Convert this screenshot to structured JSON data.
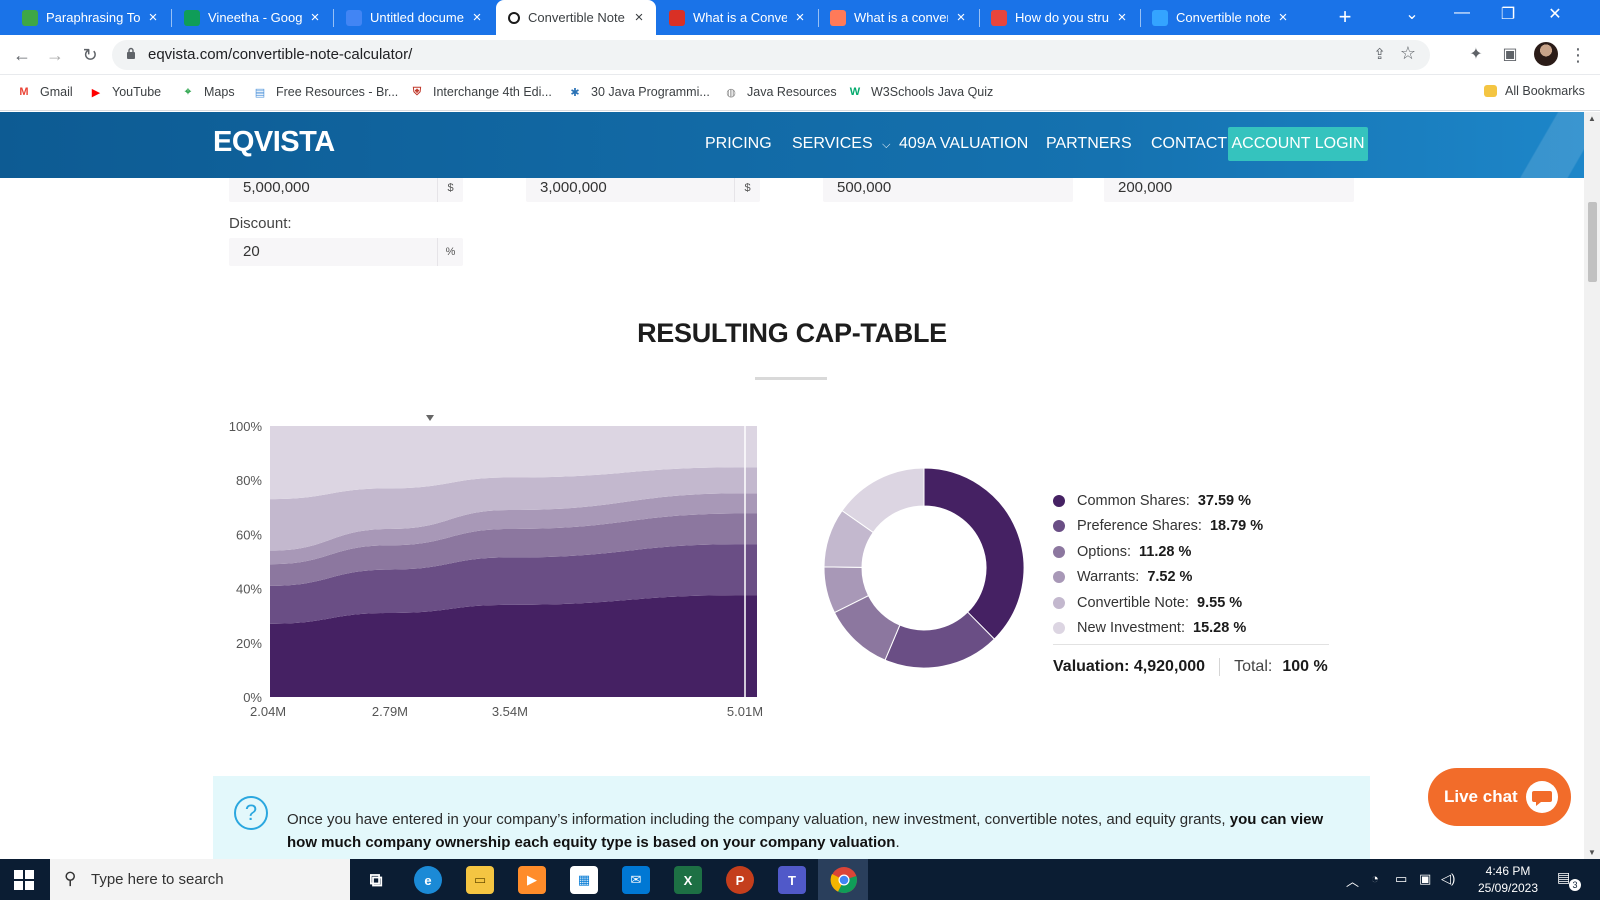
{
  "browser": {
    "tabs": [
      {
        "title": "Paraphrasing Tool",
        "icon": "quillbot-icon",
        "color": "#3ea745",
        "active": false
      },
      {
        "title": "Vineetha - Google",
        "icon": "google-sheets-icon",
        "color": "#0f9d58",
        "active": false
      },
      {
        "title": "Untitled document",
        "icon": "google-docs-icon",
        "color": "#4285f4",
        "active": false
      },
      {
        "title": "Convertible Note",
        "icon": "eqvista-icon",
        "color": "#1a1a1a",
        "active": true
      },
      {
        "title": "What is a Convertible",
        "icon": "lv-icon",
        "color": "#d93025",
        "active": false
      },
      {
        "title": "What is a convertible",
        "icon": "hubspot-icon",
        "color": "#ff7a59",
        "active": false
      },
      {
        "title": "How do you structure",
        "icon": "site-icon",
        "color": "#e8453c",
        "active": false
      },
      {
        "title": "Convertible notes",
        "icon": "site-icon",
        "color": "#34a4ff",
        "active": false
      }
    ],
    "url": "eqvista.com/convertible-note-calculator/",
    "bookmarks": [
      {
        "label": "Gmail",
        "icon": "gmail-icon",
        "color": "#ea4335"
      },
      {
        "label": "YouTube",
        "icon": "youtube-icon",
        "color": "#ff0000"
      },
      {
        "label": "Maps",
        "icon": "maps-icon",
        "color": "#34a853"
      },
      {
        "label": "Free Resources - Br...",
        "icon": "bookmark-page-icon",
        "color": "#4a90d9"
      },
      {
        "label": "Interchange 4th Edi...",
        "icon": "cambridge-icon",
        "color": "#c0392b"
      },
      {
        "label": "30 Java Programmi...",
        "icon": "java-icon",
        "color": "#2a72b5"
      },
      {
        "label": "Java Resources",
        "icon": "globe-icon",
        "color": "#888888"
      },
      {
        "label": "W3Schools Java Quiz",
        "icon": "w3schools-icon",
        "color": "#04aa6d"
      }
    ],
    "all_bookmarks": "All Bookmarks"
  },
  "site": {
    "logo": "EQVISTA",
    "nav": {
      "pricing": "PRICING",
      "services": "SERVICES",
      "valuation": "409A VALUATION",
      "partners": "PARTNERS",
      "contact": "CONTACT",
      "login": "ACCOUNT LOGIN"
    }
  },
  "inputs": {
    "field1": {
      "value": "5,000,000",
      "unit": "$"
    },
    "field2": {
      "value": "3,000,000",
      "unit": "$"
    },
    "field3": {
      "value": "500,000"
    },
    "field4": {
      "value": "200,000"
    },
    "discount": {
      "label": "Discount:",
      "value": "20",
      "unit": "%"
    }
  },
  "section_title": "RESULTING CAP-TABLE",
  "colors": {
    "common": "#452163",
    "preference": "#6a4e85",
    "options": "#8c779f",
    "warrants": "#a898b7",
    "convertible": "#c3b8ce",
    "new_investment": "#dcd5e2"
  },
  "chart_data": [
    {
      "type": "area",
      "stacked": true,
      "x": [
        2.04,
        2.79,
        3.54,
        5.01
      ],
      "x_tick_labels": [
        "2.04M",
        "2.79M",
        "3.54M",
        "5.01M"
      ],
      "y_tick_labels": [
        "0%",
        "20%",
        "40%",
        "60%",
        "80%",
        "100%"
      ],
      "ylim": [
        0,
        100
      ],
      "series": [
        {
          "name": "Common Shares",
          "values": [
            27,
            31,
            34,
            37.6
          ]
        },
        {
          "name": "Preference Shares",
          "values": [
            14,
            16,
            17.5,
            18.8
          ]
        },
        {
          "name": "Options",
          "values": [
            8,
            9,
            10.5,
            11.3
          ]
        },
        {
          "name": "Warrants",
          "values": [
            5,
            6,
            7,
            7.5
          ]
        },
        {
          "name": "Convertible Note",
          "values": [
            19,
            15,
            12,
            9.6
          ]
        },
        {
          "name": "New Investment",
          "values": [
            27,
            23,
            19,
            15.2
          ]
        }
      ]
    },
    {
      "type": "pie",
      "donut": true,
      "labels": [
        "Common Shares",
        "Preference Shares",
        "Options",
        "Warrants",
        "Convertible Note",
        "New Investment"
      ],
      "values": [
        37.59,
        18.79,
        11.28,
        7.52,
        9.55,
        15.28
      ]
    }
  ],
  "legend": [
    {
      "label": "Common Shares:",
      "value": "37.59 %"
    },
    {
      "label": "Preference Shares:",
      "value": "18.79 %"
    },
    {
      "label": "Options:",
      "value": "11.28 %"
    },
    {
      "label": "Warrants:",
      "value": "7.52 %"
    },
    {
      "label": "Convertible Note:",
      "value": "9.55 %"
    },
    {
      "label": "New Investment:",
      "value": "15.28 %"
    }
  ],
  "summary": {
    "valuation": "Valuation: 4,920,000",
    "total_label": "Total:",
    "total_value": "100 %"
  },
  "info": {
    "text": "Once you have entered in your company’s information including the company valuation, new investment, convertible notes, and equity grants, ",
    "bold": "you can view how much company ownership each equity type is based on your company valuation",
    "end": "."
  },
  "live_chat": "Live chat",
  "taskbar": {
    "search_placeholder": "Type here to search",
    "time": "4:46 PM",
    "date": "25/09/2023",
    "notifications": "3"
  }
}
